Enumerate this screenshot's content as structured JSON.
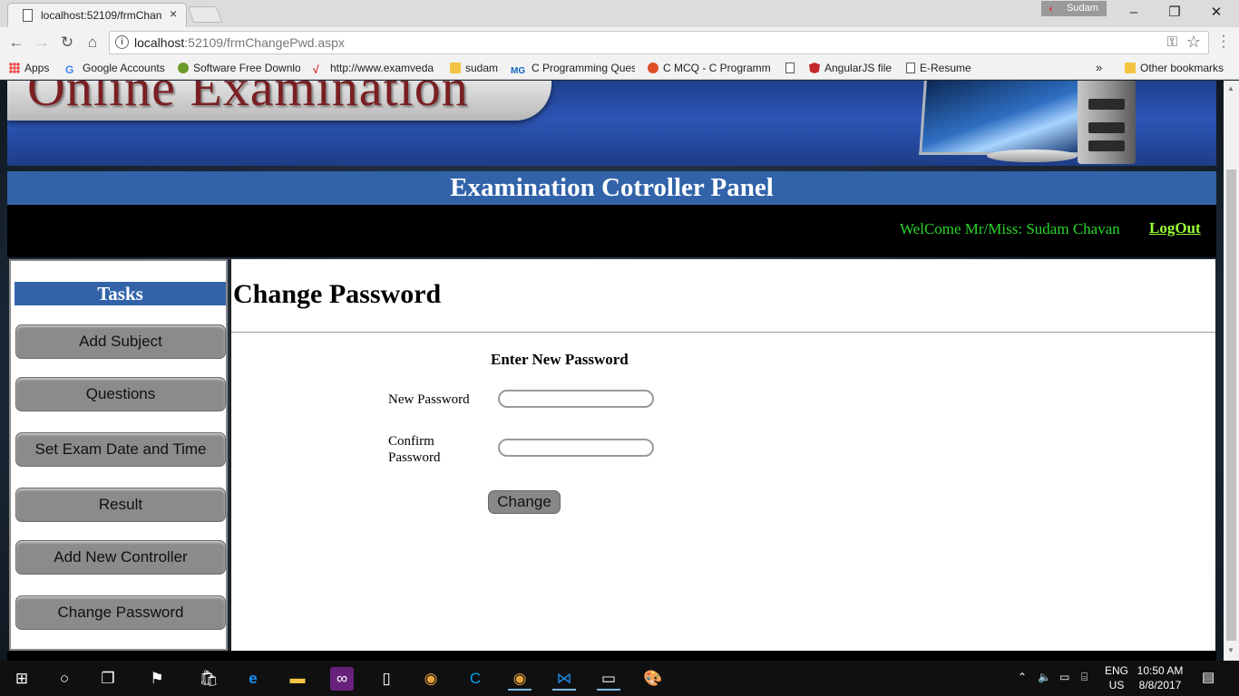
{
  "browser": {
    "tab_title": "localhost:52109/frmChan",
    "tab_close": "×",
    "profile_name": "Sudam",
    "url_host": "localhost",
    "url_path": ":52109/frmChangePwd.aspx"
  },
  "bookmarks": [
    {
      "label": "Apps",
      "icon": "apps-icon"
    },
    {
      "label": "Google Accounts",
      "icon": "google-icon"
    },
    {
      "label": "Software Free Downlo",
      "icon": "software-icon"
    },
    {
      "label": "http://www.examveda",
      "icon": "examveda-icon"
    },
    {
      "label": "sudam",
      "icon": "folder-icon"
    },
    {
      "label": "C Programming Ques",
      "icon": "mg-icon"
    },
    {
      "label": "C MCQ - C Programm",
      "icon": "cmcq-icon"
    },
    {
      "label": "AngularJS file",
      "icon": "angular-icon"
    },
    {
      "label": "E-Resume",
      "icon": "doc-icon"
    },
    {
      "label": "Other bookmarks",
      "icon": "folder-icon"
    }
  ],
  "bookmarks_overflow": "»",
  "header": {
    "banner_text": "Online Examination",
    "panel_title": "Examination Cotroller Panel",
    "welcome": "WelCome Mr/Miss: Sudam Chavan",
    "logout": "LogOut"
  },
  "sidebar": {
    "title": "Tasks",
    "items": [
      {
        "label": "Add Subject"
      },
      {
        "label": "Questions"
      },
      {
        "label": "Set Exam Date and Time"
      },
      {
        "label": "Result"
      },
      {
        "label": "Add New Controller"
      },
      {
        "label": "Change Password"
      }
    ]
  },
  "main": {
    "title": "Change Password",
    "form_heading": "Enter New Password",
    "new_password_label": "New Password",
    "confirm_label_line1": "Confirm",
    "confirm_label_line2": "Password",
    "new_password_value": "",
    "confirm_password_value": "",
    "change_button": "Change"
  },
  "taskbar": {
    "lang_line1": "ENG",
    "lang_line2": "US",
    "time": "10:50 AM",
    "date": "8/8/2017"
  }
}
